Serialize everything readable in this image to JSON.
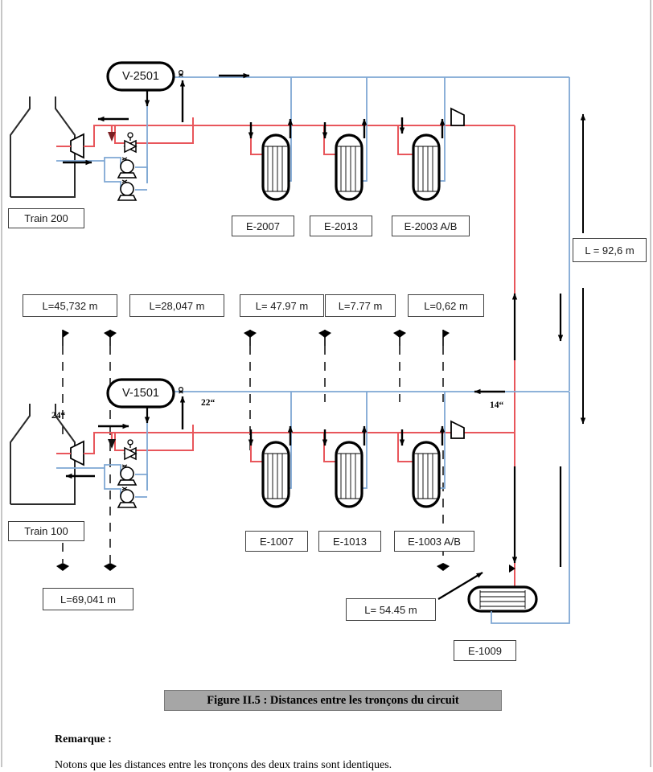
{
  "figure": {
    "caption": "Figure II.5 : Distances entre les tronçons du circuit",
    "remark_title": "Remarque :",
    "remark_body": "Notons que les distances entre les tronçons des deux trains sont identiques."
  },
  "colors": {
    "hot_line": "#E8565B",
    "cold_line": "#7FA8D4",
    "equipment_outline": "#000000",
    "label_border": "#404040",
    "caption_bg": "#A6A6A6"
  },
  "trains": [
    {
      "id": "train-200",
      "label": "Train 200"
    },
    {
      "id": "train-100",
      "label": "Train 100"
    }
  ],
  "vessels": [
    {
      "id": "v-2501",
      "label": "V-2501"
    },
    {
      "id": "v-1501",
      "label": "V-1501"
    }
  ],
  "exchangers_top": [
    {
      "id": "e-2007",
      "label": "E-2007"
    },
    {
      "id": "e-2013",
      "label": "E-2013"
    },
    {
      "id": "e-2003",
      "label": "E-2003 A/B"
    }
  ],
  "exchangers_bottom": [
    {
      "id": "e-1007",
      "label": "E-1007"
    },
    {
      "id": "e-1013",
      "label": "E-1013"
    },
    {
      "id": "e-1003",
      "label": "E-1003 A/B"
    }
  ],
  "exchanger_horizontal": {
    "id": "e-1009",
    "label": "E-1009"
  },
  "distance_labels": [
    {
      "id": "dist-1",
      "label": "L=45,732 m"
    },
    {
      "id": "dist-2",
      "label": "L=28,047 m"
    },
    {
      "id": "dist-3",
      "label": "L= 47.97 m"
    },
    {
      "id": "dist-4",
      "label": "L=7.77 m"
    },
    {
      "id": "dist-5",
      "label": "L=0,62 m"
    },
    {
      "id": "dist-vertical",
      "label": "L = 92,6 m"
    },
    {
      "id": "dist-bottom",
      "label": "L=69,041 m"
    },
    {
      "id": "dist-e1009",
      "label": "L= 54.45 m"
    }
  ],
  "pipe_sizes": [
    {
      "id": "size-24",
      "label": "24“"
    },
    {
      "id": "size-22",
      "label": "22“"
    },
    {
      "id": "size-14",
      "label": "14“"
    }
  ],
  "chart_data": {
    "type": "diagram",
    "title": "Figure II.5 : Distances entre les tronçons du circuit",
    "description": "Process flow diagram of two identical circuit trains (Train 100 and Train 200) showing hot (red) and cold (blue) piping runs between storage tanks, separator vessels V-1501/V-2501, pumps, control valves and shell-and-tube heat exchangers, annotated with segment distances.",
    "segments": [
      {
        "name": "Segment 1",
        "length_m": 45.732,
        "label": "L=45,732 m"
      },
      {
        "name": "Segment 2",
        "length_m": 28.047,
        "label": "L=28,047 m"
      },
      {
        "name": "Segment 3",
        "length_m": 47.97,
        "label": "L= 47.97 m"
      },
      {
        "name": "Segment 4",
        "length_m": 7.77,
        "label": "L=7.77 m"
      },
      {
        "name": "Segment 5",
        "length_m": 0.62,
        "label": "L=0,62 m"
      },
      {
        "name": "Vertical run between trains",
        "length_m": 92.6,
        "label": "L = 92,6 m"
      },
      {
        "name": "Tank to vessel bottom run",
        "length_m": 69.041,
        "label": "L=69,041 m"
      },
      {
        "name": "Run to E-1009",
        "length_m": 54.45,
        "label": "L= 54.45 m"
      }
    ],
    "pipe_diameters_inch": [
      24,
      22,
      14
    ],
    "equipment": [
      "Train 200 tank",
      "V-2501",
      "E-2007",
      "E-2013",
      "E-2003 A/B",
      "Train 100 tank",
      "V-1501",
      "E-1007",
      "E-1013",
      "E-1003 A/B",
      "E-1009"
    ]
  }
}
